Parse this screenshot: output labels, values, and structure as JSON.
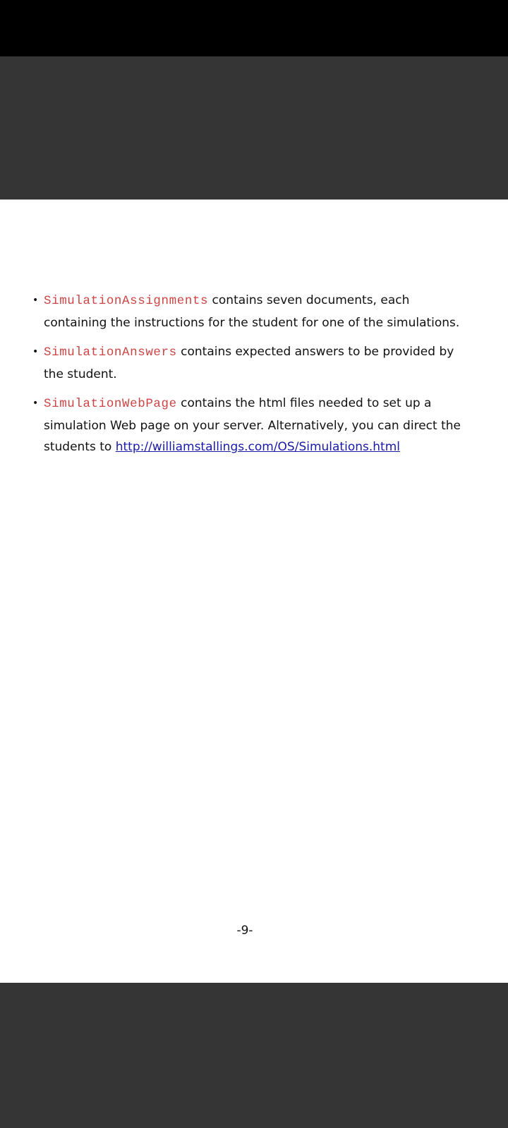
{
  "document": {
    "items": [
      {
        "code": "SimulationAssignments",
        "text": " contains seven documents, each containing the instructions for the student for one of the simulations."
      },
      {
        "code": "SimulationAnswers",
        "text": " contains expected answers to be provided by the student."
      },
      {
        "code": "SimulationWebPage",
        "text": " contains the html files needed to set up a simulation Web page on your server. Alternatively, you can direct the students to ",
        "link": "http://williamstallings.com/OS/Simulations.html"
      }
    ],
    "bullet_glyph": "•",
    "page_number": "-9-"
  },
  "colors": {
    "code_text": "#cc4444",
    "link_text": "#1a1aa6",
    "viewer_background": "#353535",
    "status_bar": "#000000",
    "page_background": "#ffffff"
  }
}
